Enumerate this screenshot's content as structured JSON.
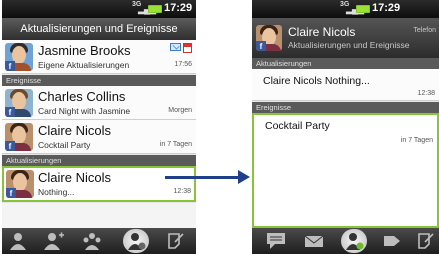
{
  "left_phone": {
    "status": {
      "network": "3G",
      "time": "17:29"
    },
    "title": "Aktualisierungen und Ereignisse",
    "top_item": {
      "name": "Jasmine Brooks",
      "subtitle": "Eigene Aktualisierungen",
      "time": "17:56"
    },
    "events_section_label": "Ereignisse",
    "events": [
      {
        "name": "Charles Collins",
        "subtitle": "Card Night with Jasmine",
        "meta": "Morgen"
      },
      {
        "name": "Claire Nicols",
        "subtitle": "Cocktail Party",
        "meta": "in 7 Tagen"
      }
    ],
    "updates_section_label": "Aktualisierungen",
    "updates": [
      {
        "name": "Claire Nicols",
        "subtitle": "Nothing...",
        "time": "12:38"
      }
    ],
    "tabs": [
      "people-icon",
      "add-person-icon",
      "group-icon",
      "updates-events-icon",
      "call-log-icon"
    ]
  },
  "right_phone": {
    "status": {
      "network": "3G",
      "time": "17:29"
    },
    "contact_name": "Claire Nicols",
    "contact_subtitle": "Aktualisierungen und Ereignisse",
    "contact_phone_label": "Telefon",
    "updates_section_label": "Aktualisierungen",
    "update_item": {
      "title": "Claire Nicols Nothing...",
      "time": "12:38"
    },
    "events_section_label": "Ereignisse",
    "event_item": {
      "title": "Cocktail Party",
      "meta": "in 7 Tagen"
    },
    "tabs": [
      "message-icon",
      "mail-icon",
      "contact-updates-icon",
      "tag-icon",
      "call-log-icon"
    ]
  },
  "colors": {
    "accent_green": "#87c43a",
    "arrow_blue": "#1f3f8a",
    "facebook_blue": "#3b5998"
  }
}
